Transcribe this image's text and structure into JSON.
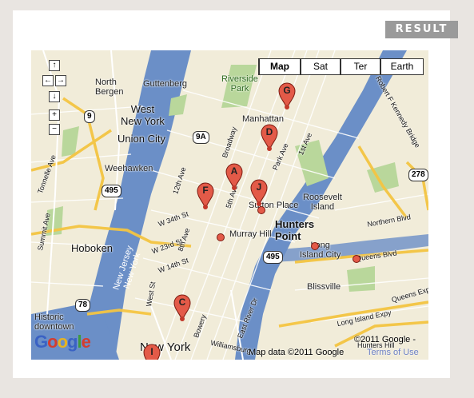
{
  "result_label": "RESULT",
  "map_types": [
    {
      "label": "Map",
      "active": true
    },
    {
      "label": "Sat",
      "active": false
    },
    {
      "label": "Ter",
      "active": false
    },
    {
      "label": "Earth",
      "active": false
    }
  ],
  "pan_controls": [
    "↑",
    "←",
    "→",
    "↓",
    "+",
    "−"
  ],
  "labels": {
    "north_bergen": "North\nBergen",
    "guttenberg": "Guttenberg",
    "west_new_york": "West\nNew York",
    "union_city": "Union City",
    "weehawken": "Weehawken",
    "hoboken": "Hoboken",
    "riverside_park": "Riverside\nPark",
    "manhattan": "Manhattan",
    "sutton_place": "Sutton Place",
    "roosevelt_island": "Roosevelt\nIsland",
    "hunters_point": "Hunters\nPoint",
    "murray_hill": "Murray Hill",
    "long_island_city": "Long\nIsland City",
    "queens_blvd": "Queens Blvd",
    "northern_blvd": "Northern Blvd",
    "blissville": "Blissville",
    "historic_downtown": "Historic\ndowntown",
    "new_york": "New York",
    "new_jersey_ny": "New Jersey\nNew York",
    "w34th": "W 34th St",
    "w14th": "W 14th St",
    "w23rd": "W 23rd St",
    "broadway": "Broadway",
    "fifth_ave": "5th Ave",
    "park_ave": "Park Ave",
    "first_ave": "1st Ave",
    "twelfth_ave": "12th Ave",
    "eighth_ave": "8th Ave",
    "west_st": "West St",
    "bowery": "Bowery",
    "east_river_dr": "East River Dr",
    "summit_ave": "Summit Ave",
    "tonnelle_ave": "Tonnelle Ave",
    "rfk_bridge": "Robert F Kennedy Bridge",
    "long_island_expy": "Long Island Expy",
    "queens_expy": "Queens Expy",
    "williamsburg": "Williamsburg",
    "hunters_hill": "Hunters Hill"
  },
  "shields": {
    "s9": "9",
    "s9a": "9A",
    "s495a": "495",
    "s495b": "495",
    "s278": "278",
    "s78": "78"
  },
  "markers": [
    {
      "letter": "G"
    },
    {
      "letter": "D"
    },
    {
      "letter": "A"
    },
    {
      "letter": "F"
    },
    {
      "letter": "J"
    },
    {
      "letter": "C"
    },
    {
      "letter": "I"
    }
  ],
  "google_logo": "Google",
  "copyright": "©2011 Google -",
  "attribution": "Map data ©2011 Google",
  "terms": "Terms of Use",
  "colors": {
    "water": "#6b8fc7",
    "land": "#f1ecd9",
    "park": "#b9d79b",
    "highway": "#f4c542",
    "marker": "#e35a48"
  }
}
